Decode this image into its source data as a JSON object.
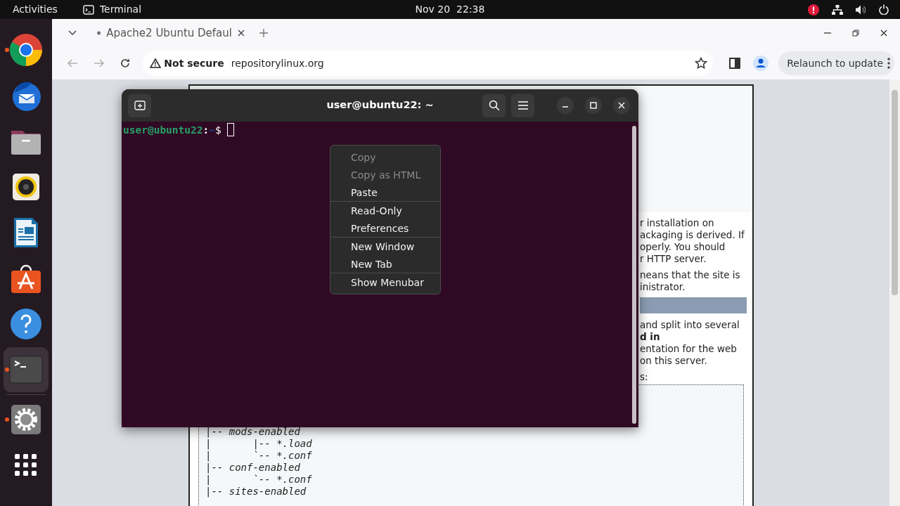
{
  "top_bar": {
    "activities": "Activities",
    "app_name": "Terminal",
    "clock": "Nov 20  22:38"
  },
  "dock": {
    "items": [
      {
        "kind": "chrome",
        "running": true,
        "selected": false
      },
      {
        "kind": "mail",
        "running": false,
        "selected": false
      },
      {
        "kind": "files",
        "running": false,
        "selected": false
      },
      {
        "kind": "music",
        "running": false,
        "selected": false
      },
      {
        "kind": "writer",
        "running": false,
        "selected": false
      },
      {
        "kind": "store",
        "running": false,
        "selected": false
      },
      {
        "kind": "help",
        "running": false,
        "selected": false
      },
      {
        "kind": "terminal",
        "running": true,
        "selected": true
      },
      {
        "kind": "separator"
      },
      {
        "kind": "settings",
        "running": true,
        "selected": false
      },
      {
        "kind": "apps",
        "running": false,
        "selected": false
      }
    ]
  },
  "browser": {
    "tab": {
      "title": "Apache2 Ubuntu Defaul"
    },
    "nav_buttons": [
      {
        "kind": "back",
        "disabled": true
      },
      {
        "kind": "forward",
        "disabled": true
      },
      {
        "kind": "reload",
        "disabled": false
      }
    ],
    "address": {
      "security": "Not secure",
      "url": "repositorylinux.org"
    },
    "relaunch_button": "Relaunch to update"
  },
  "web_page": {
    "paragraphs": [
      [
        "r installation on",
        "ackaging is derived. If",
        "operly. You should",
        "r HTTP server."
      ],
      [
        "neans that the site is",
        "inistrator."
      ],
      [
        "and split into several",
        "**d in**",
        "entation for the web",
        "on this server."
      ],
      [
        "s:"
      ]
    ],
    "pre_lines": [
      "|-- mods-enabled",
      "|       |-- *.load",
      "|       `-- *.conf",
      "|-- conf-enabled",
      "|       `-- *.conf",
      "|-- sites-enabled"
    ]
  },
  "terminal": {
    "title": "user@ubuntu22: ~",
    "prompt": {
      "user_host": "user@ubuntu22",
      "separator": ":",
      "path": "~",
      "symbol": "$"
    }
  },
  "context_menu": {
    "sections": [
      [
        {
          "label": "Copy",
          "disabled": true
        },
        {
          "label": "Copy as HTML",
          "disabled": true
        },
        {
          "label": "Paste",
          "disabled": false
        }
      ],
      [
        {
          "label": "Read-Only",
          "disabled": false
        },
        {
          "label": "Preferences",
          "disabled": false
        }
      ],
      [
        {
          "label": "New Window",
          "disabled": false
        },
        {
          "label": "New Tab",
          "disabled": false
        }
      ],
      [
        {
          "label": "Show Menubar",
          "disabled": false
        }
      ]
    ]
  }
}
